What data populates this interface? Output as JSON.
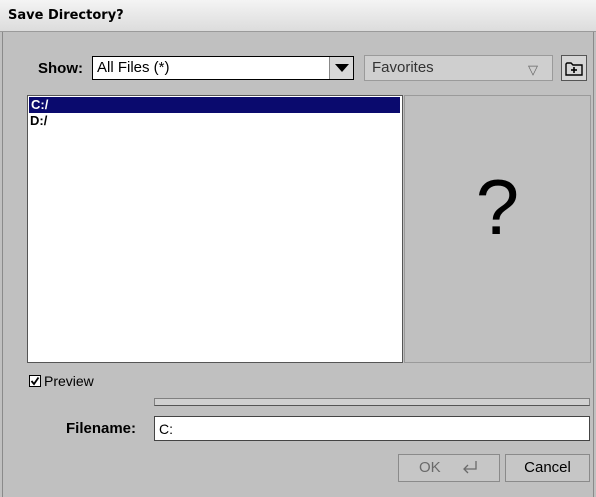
{
  "window": {
    "title": "Save Directory?"
  },
  "filter": {
    "label": "Show:",
    "value": "All Files (*)"
  },
  "favorites": {
    "value": "Favorites"
  },
  "file_list": {
    "items": [
      {
        "label": "C:/",
        "selected": true
      },
      {
        "label": "D:/",
        "selected": false
      }
    ]
  },
  "preview": {
    "placeholder": "?",
    "checkbox_label": "Preview",
    "checked": true
  },
  "filename": {
    "label": "Filename:",
    "value": "C:"
  },
  "buttons": {
    "ok": "OK",
    "cancel": "Cancel"
  },
  "icons": {
    "filter_dropdown": "triangle-down-icon",
    "favorites_dropdown": "triangle-down-outline-icon",
    "new_folder": "new-folder-icon",
    "checkbox": "checkmark-icon",
    "ok_enter": "enter-key-icon"
  },
  "colors": {
    "selection_bg": "#0a0a6e",
    "dialog_bg": "#c0c0c0"
  }
}
